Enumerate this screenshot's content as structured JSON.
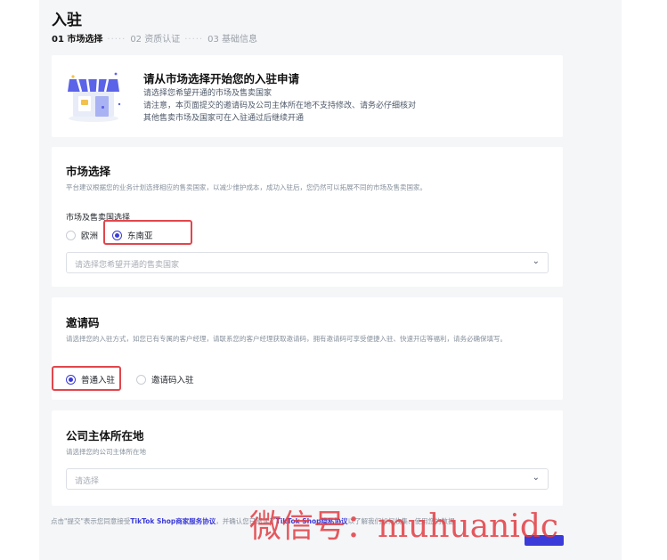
{
  "page": {
    "title": "入驻",
    "steps": [
      {
        "label": "01 市场选择",
        "state": "active"
      },
      {
        "label": "02 资质认证",
        "state": "pending"
      },
      {
        "label": "03 基础信息",
        "state": "pending"
      }
    ],
    "step_separator": "·····"
  },
  "intro": {
    "icon": "shop-storefront-illustration",
    "heading": "请从市场选择开始您的入驻申请",
    "lines": [
      "请选择您希望开通的市场及售卖国家",
      "请注意，本页面提交的邀请码及公司主体所在地不支持修改、请务必仔细核对",
      "其他售卖市场及国家可在入驻通过后继续开通"
    ]
  },
  "market": {
    "title": "市场选择",
    "description": "平台建议根据您的业务计划选择相应的售卖国家，以减少维护成本，成功入驻后，您仍然可以拓展不同的市场及售卖国家。",
    "field_label": "市场及售卖国选择",
    "options": [
      {
        "label": "欧洲",
        "selected": false
      },
      {
        "label": "东南亚",
        "selected": true
      }
    ],
    "country_select_placeholder": "请选择您希望开通的售卖国家"
  },
  "invite": {
    "title": "邀请码",
    "description": "请选择您的入驻方式，如您已有专属的客户经理，请联系您的客户经理获取邀请码，拥有邀请码可享受便捷入驻、快速开店等福利，请务必确保填写。",
    "options": [
      {
        "label": "普通入驻",
        "selected": true
      },
      {
        "label": "邀请码入驻",
        "selected": false
      }
    ]
  },
  "company": {
    "title": "公司主体所在地",
    "description": "请选择您的公司主体所在地",
    "select_placeholder": "请选择"
  },
  "footer": {
    "text_1": "点击\"提交\"表示您同意接受",
    "link_1": "TikTok Shop商家服务协议",
    "text_2": "，并确认您已阅读了",
    "link_2": "TikTok Shop隐私协议",
    "text_3": "以了解我们如何收集、使用您的数据"
  },
  "watermark": "微信号：muhuanidc",
  "colors": {
    "accent": "#3b3bd9",
    "highlight": "#e2464c",
    "background": "#f5f6f8"
  }
}
